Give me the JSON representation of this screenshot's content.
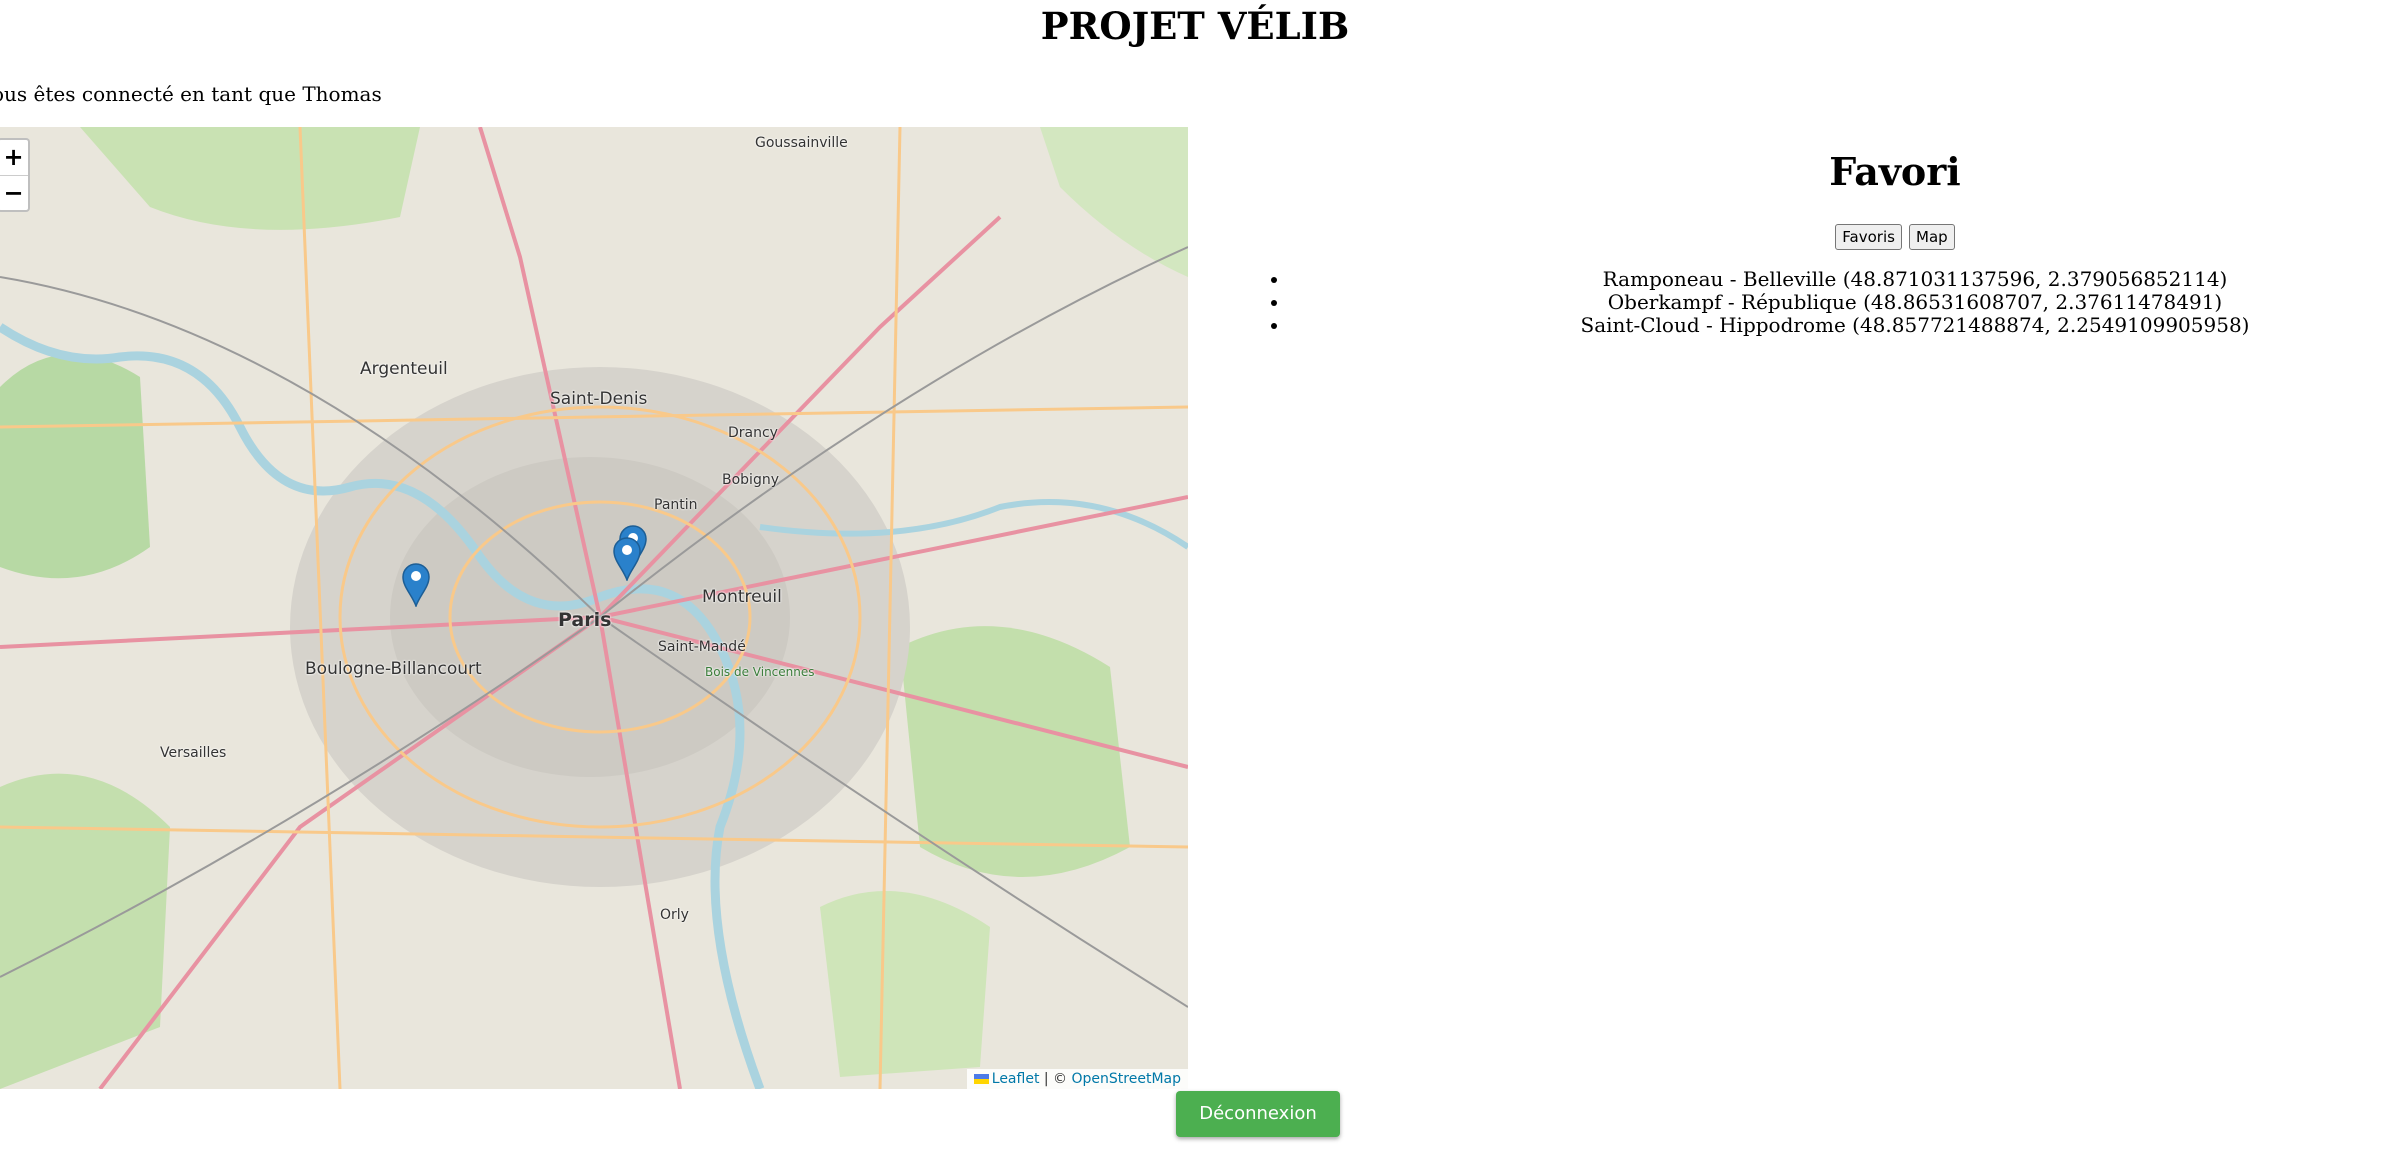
{
  "header": {
    "title": "PROJET VÉLIB",
    "user_line": "ous êtes connecté en tant que Thomas"
  },
  "map": {
    "zoom_in": "+",
    "zoom_out": "−",
    "labels": {
      "paris": "Paris",
      "saint_denis": "Saint-Denis",
      "argenteuil": "Argenteuil",
      "montreuil": "Montreuil",
      "boulogne": "Boulogne-Billancourt",
      "vincennes": "Bois de Vincennes",
      "goussainville": "Goussainville",
      "pantin": "Pantin",
      "saint_mande": "Saint-Mandé",
      "versailles": "Versailles",
      "orly": "Orly",
      "drancy": "Drancy",
      "bobigny": "Bobigny"
    },
    "attribution": {
      "leaflet": "Leaflet",
      "separator": " | © ",
      "osm": "OpenStreetMap"
    },
    "markers": [
      {
        "name": "Ramponeau - Belleville"
      },
      {
        "name": "Oberkampf - République"
      },
      {
        "name": "Saint-Cloud - Hippodrome"
      }
    ]
  },
  "favorites": {
    "title": "Favori",
    "buttons": {
      "favoris": "Favoris",
      "map": "Map"
    },
    "items": [
      "Ramponeau - Belleville (48.871031137596, 2.379056852114)",
      "Oberkampf - République (48.86531608707, 2.37611478491)",
      "Saint-Cloud - Hippodrome (48.857721488874, 2.2549109905958)"
    ]
  },
  "logout_label": "Déconnexion",
  "colors": {
    "logout_bg": "#4caf50",
    "marker": "#2a81cb",
    "link": "#0078a8"
  }
}
